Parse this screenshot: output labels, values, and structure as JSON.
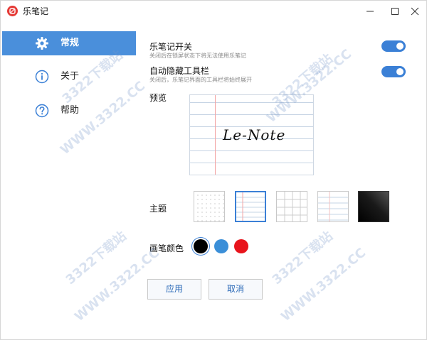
{
  "titlebar": {
    "title": "乐笔记"
  },
  "sidebar": {
    "items": [
      {
        "label": "常规",
        "icon": "gear-icon",
        "active": true
      },
      {
        "label": "关于",
        "icon": "info-icon",
        "active": false
      },
      {
        "label": "帮助",
        "icon": "help-icon",
        "active": false
      }
    ]
  },
  "settings": {
    "toggle1": {
      "title": "乐笔记开关",
      "desc": "关闭后在锁屏状态下将无法使用乐笔记",
      "on": true
    },
    "toggle2": {
      "title": "自动隐藏工具栏",
      "desc": "关闭后，乐笔记界面的工具栏将始终展开",
      "on": true
    },
    "preview_label": "预览",
    "preview_text": "Le-Note",
    "theme_label": "主题",
    "themes": [
      {
        "name": "dots",
        "selected": false
      },
      {
        "name": "lined-margin",
        "selected": true
      },
      {
        "name": "grid",
        "selected": false
      },
      {
        "name": "lined",
        "selected": false
      },
      {
        "name": "dark",
        "selected": false
      }
    ],
    "pen_color_label": "画笔颜色",
    "pen_colors": [
      {
        "color": "#000000",
        "selected": true
      },
      {
        "color": "#3b8fd8",
        "selected": false
      },
      {
        "color": "#e8141c",
        "selected": false
      }
    ]
  },
  "buttons": {
    "apply": "应用",
    "cancel": "取消"
  },
  "watermark": {
    "site": "WWW.3322.CC",
    "brand": "3322下载站"
  },
  "colors": {
    "accent": "#3b80d6",
    "sidebar_active": "#4a8fdb",
    "logo": "#e53935"
  }
}
